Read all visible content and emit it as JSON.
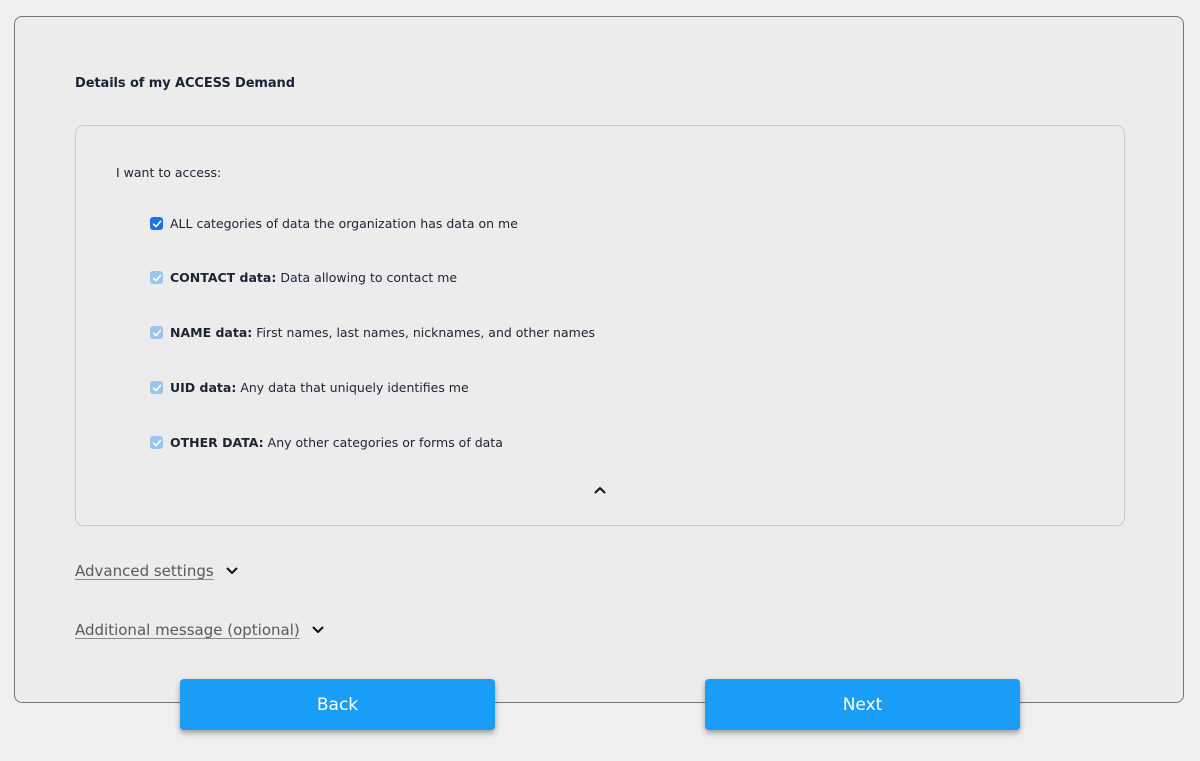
{
  "form": {
    "section_title": "Details of my ACCESS Demand",
    "access_label": "I want to access:",
    "options": [
      {
        "strong": "",
        "text": "ALL categories of data the organization has data on me",
        "checked": true,
        "state": "primary"
      },
      {
        "strong": "CONTACT data:",
        "text": "Data allowing to contact me",
        "checked": true,
        "state": "secondary"
      },
      {
        "strong": "NAME data:",
        "text": "First names, last names, nicknames, and other names",
        "checked": true,
        "state": "secondary"
      },
      {
        "strong": "UID data:",
        "text": "Any data that uniquely identifies me",
        "checked": true,
        "state": "secondary"
      },
      {
        "strong": "OTHER DATA:",
        "text": "Any other categories or forms of data",
        "checked": true,
        "state": "secondary"
      }
    ],
    "advanced_settings_label": "Advanced settings",
    "additional_message_label": "Additional message (optional)"
  },
  "buttons": {
    "back_label": "Back",
    "next_label": "Next"
  },
  "colors": {
    "primary_button": "#1a9df7",
    "checkbox_checked": "#1b74e4",
    "checkbox_disabled_checked": "#9bc4ef"
  },
  "icons": {
    "collapse": "chevron-up-icon",
    "expand": "chevron-down-icon",
    "check": "checkmark-icon"
  }
}
